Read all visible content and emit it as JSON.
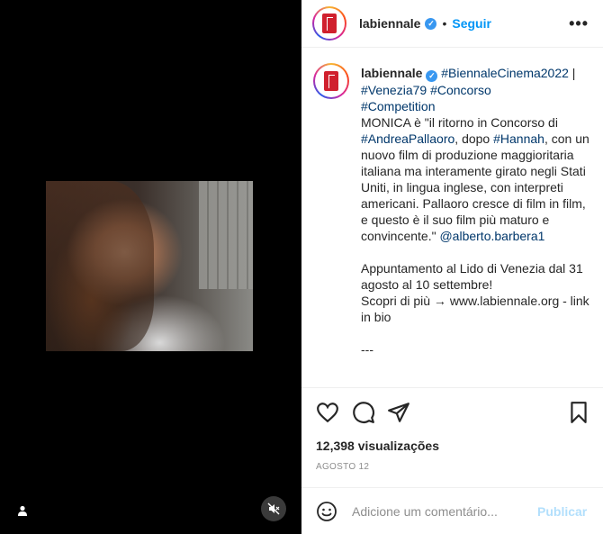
{
  "post": {
    "username": "labiennale",
    "follow_label": "Seguir",
    "dot": "•",
    "more_label": "•••"
  },
  "caption": {
    "username": "labiennale",
    "segments": [
      {
        "text": " ",
        "type": "text"
      },
      {
        "text": "#BiennaleCinema2022",
        "type": "tag"
      },
      {
        "text": " | ",
        "type": "text"
      },
      {
        "text": "#Venezia79",
        "type": "tag"
      },
      {
        "text": " ",
        "type": "text"
      },
      {
        "text": "#Concorso",
        "type": "tag"
      },
      {
        "text": "\n",
        "type": "text"
      },
      {
        "text": "#Competition",
        "type": "tag"
      },
      {
        "text": "\nMONICA è \"il ritorno in Concorso di ",
        "type": "text"
      },
      {
        "text": "#AndreaPallaoro",
        "type": "tag"
      },
      {
        "text": ", dopo ",
        "type": "text"
      },
      {
        "text": "#Hannah",
        "type": "tag"
      },
      {
        "text": ", con un nuovo film di produzione maggioritaria italiana ma interamente girato negli Stati Uniti, in lingua inglese, con interpreti americani. Pallaoro cresce di film in film, e questo è il suo film più maturo e convincente.\" ",
        "type": "text"
      },
      {
        "text": "@alberto.barbera1",
        "type": "tag"
      },
      {
        "text": "\n\nAppuntamento al Lido di Venezia dal 31 agosto al 10 settembre!\nScopri di più → www.labiennale.org - link in bio\n\n---",
        "type": "text"
      }
    ]
  },
  "stats": {
    "views": "12,398 visualizações",
    "date": "AGOSTO 12"
  },
  "comment": {
    "placeholder": "Adicione um comentário...",
    "publish_label": "Publicar"
  },
  "colors": {
    "link": "#00376b",
    "follow": "#0095f6",
    "publish_disabled": "#b2dffc",
    "verified": "#3897f0",
    "brand_logo": "#d0202e"
  },
  "icons": [
    "user-tag-icon",
    "mute-icon",
    "verified-icon",
    "more-icon",
    "heart-icon",
    "comment-icon",
    "share-icon",
    "save-icon",
    "emoji-icon"
  ]
}
